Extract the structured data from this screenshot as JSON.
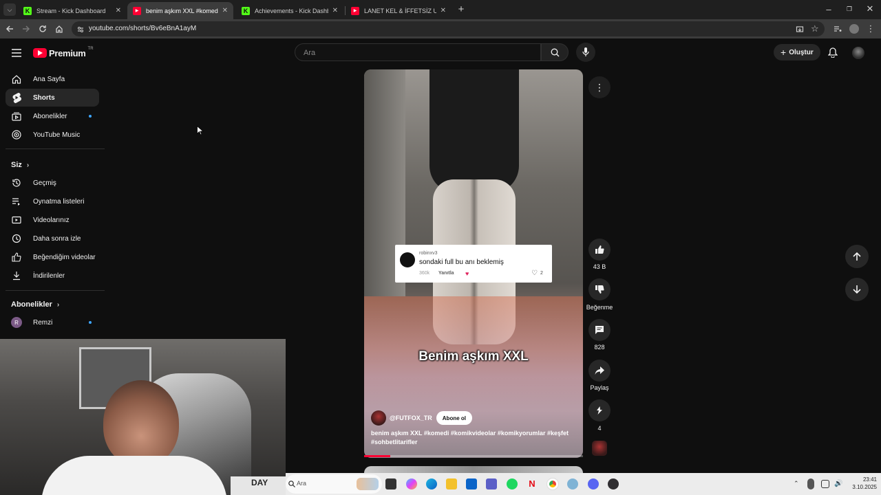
{
  "browser": {
    "tabs": [
      {
        "label": "Stream - Kick Dashboard",
        "favicon": "kick-icon"
      },
      {
        "label": "benim aşkım XXL #komedi #kom",
        "favicon": "youtube-icon"
      },
      {
        "label": "Achievements - Kick Dashboard",
        "favicon": "kick-icon"
      },
      {
        "label": "LANET KEL & İFFETSİZ UMUT -",
        "favicon": "youtube-icon"
      }
    ],
    "url": "youtube.com/shorts/Bv6eBnA1ayM"
  },
  "header": {
    "logo_text": "Premium",
    "logo_region": "TR",
    "search_placeholder": "Ara",
    "create_label": "Oluştur"
  },
  "sidebar": {
    "main": [
      {
        "label": "Ana Sayfa",
        "icon": "home-icon"
      },
      {
        "label": "Shorts",
        "icon": "shorts-icon"
      },
      {
        "label": "Abonelikler",
        "icon": "subscriptions-icon"
      },
      {
        "label": "YouTube Music",
        "icon": "music-icon"
      }
    ],
    "you_heading": "Siz",
    "you": [
      {
        "label": "Geçmiş",
        "icon": "history-icon"
      },
      {
        "label": "Oynatma listeleri",
        "icon": "playlists-icon"
      },
      {
        "label": "Videolarınız",
        "icon": "your-videos-icon"
      },
      {
        "label": "Daha sonra izle",
        "icon": "watch-later-icon"
      },
      {
        "label": "Beğendiğim videolar",
        "icon": "liked-videos-icon"
      },
      {
        "label": "İndirilenler",
        "icon": "downloads-icon"
      }
    ],
    "subs_heading": "Abonelikler",
    "subs": [
      {
        "label": "Remzi",
        "avatar_letter": "R"
      }
    ]
  },
  "short": {
    "comment": {
      "user": "robinxv3",
      "text": "sondaki full bu anı beklemiş",
      "time": "360k",
      "reply": "Yanıtla",
      "likes": "2"
    },
    "caption": "Benim aşkım XXL",
    "channel": "@FUTFOX_TR",
    "subscribe_label": "Abone ol",
    "title": "benim aşkım XXL #komedi #komikvideolar #komikyorumlar #keşfet #sohbetlitarifler",
    "progress": 0.12
  },
  "actions": {
    "likes": "43 B",
    "dislike_label": "Beğenme",
    "comments": "828",
    "share_label": "Paylaş",
    "remix_count": "4"
  },
  "taskbar": {
    "search_placeholder": "Ara",
    "time": "23:41",
    "date": "3.10.2025",
    "colors": {
      "youtube_red": "#ff0033",
      "kick_green": "#53fc18"
    }
  }
}
